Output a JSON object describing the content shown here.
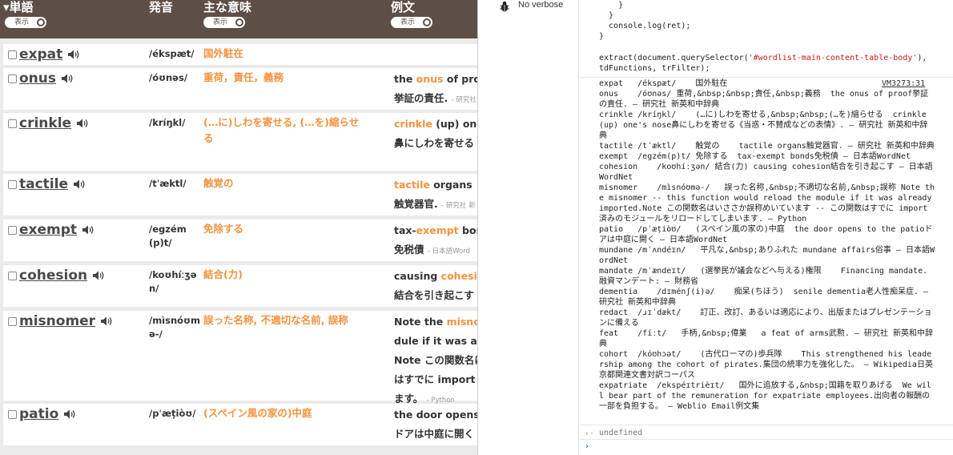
{
  "header": {
    "col_word": "▾単語",
    "col_pron": "発音",
    "col_meaning": "主な意味",
    "col_example": "例文",
    "toggle_label": "表示"
  },
  "rows": [
    {
      "word": "expat",
      "pron": "/ékspæt/",
      "meaning": "国外駐在",
      "example": []
    },
    {
      "word": "onus",
      "pron": "/óʊnəs/",
      "meaning": "重荷，責任，義務",
      "example": [
        [
          "the ",
          "onus",
          " of proof"
        ],
        [
          "挙証の責任.",
          "",
          ""
        ]
      ],
      "source": "- 研究社"
    },
    {
      "word": "crinkle",
      "pron": "/kríŋkl/",
      "meaning": "(…に)しわを寄せる, (…を)縮らせる",
      "example": [
        [
          "",
          "crinkle",
          " (up) one's"
        ],
        [
          "鼻にしわを寄せる",
          "",
          ""
        ]
      ],
      "source": "和中辞典"
    },
    {
      "word": "tactile",
      "pron": "/tˈæktl/",
      "meaning": "触覚の",
      "example": [
        [
          "",
          "tactile",
          " organs"
        ],
        [
          "触覚器官.",
          "",
          ""
        ]
      ],
      "source": "- 研究社 新"
    },
    {
      "word": "exempt",
      "pron": "/egzém(p)t/",
      "meaning": "免除する",
      "example": [
        [
          "tax-",
          "exempt",
          " bonds"
        ],
        [
          "免税債",
          "",
          ""
        ]
      ],
      "source": "- 日本語Word"
    },
    {
      "word": "cohesion",
      "pron": "/koʊhíːʒən/",
      "meaning": "結合(力)",
      "example": [
        [
          "causing ",
          "cohesion",
          ""
        ],
        [
          "結合を引き起こす",
          "",
          ""
        ]
      ]
    },
    {
      "word": "misnomer",
      "pron": "/mìsnóʊmə-/",
      "meaning": "誤った名称, 不適切な名前, 誤称",
      "example": [
        [
          "Note the ",
          "misnomer",
          ""
        ],
        [
          "dule if it was already",
          "",
          ""
        ],
        [
          "Note この関数名は",
          "",
          ""
        ],
        [
          "はすでに import 済",
          "",
          ""
        ],
        [
          "ます。",
          "",
          ""
        ]
      ],
      "source": "- Python"
    },
    {
      "word": "patio",
      "pron": "/pˈæṭiòʊ/",
      "meaning": "(スペイン風の家の)中庭",
      "example": [
        [
          "the door opens to",
          "",
          ""
        ],
        [
          "ドアは中庭に開く",
          "",
          ""
        ]
      ]
    }
  ],
  "console": {
    "verbose_label": "No verbose",
    "code_lines": [
      "    }",
      "  }",
      "  console.log(ret);",
      "}"
    ],
    "command_prefix": "extract(document.querySelector(",
    "command_string": "'#wordlist-main-content-table-body'",
    "command_suffix": "), tdFunctions, trFilter);",
    "vm_link": "VM3273:31",
    "output": "expat   /ékspæt/    国外駐在\nonus    /óʊnəs/ 重荷,&nbsp;&nbsp;責任,&nbsp;義務  the onus of proof挙証の責任. – 研究社 新英和中辞典\ncrinkle /kríŋkl/    (…に)しわを寄せる,&nbsp;&nbsp;(…を)縮らせる  crinkle (up) one's nose鼻にしわを寄せる《当惑・不賛成などの表情》. – 研究社 新英和中辞典\ntactile /tˈæktl/    触覚の    tactile organs触覚器官. – 研究社 新英和中辞典\nexempt  /egzém(p)t/ 免除する  tax-exempt bonds免税債 – 日本語WordNet\ncohesion    /koʊhíːʒən/ 結合(力) causing cohesion結合を引き起こす – 日本語WordNet\nmisnomer    /mìsnóʊmə-/   誤った名称,&nbsp;不適切な名前,&nbsp;誤称 Note the misnomer -- this function would reload the module if it was already imported.Note この関数名はいささか誤称めいています -- この関数はすでに import 済みのモジュールをリロードしてしまいます. – Python\npatio   /pˈæṭiòʊ/   (スペイン風の家の)中庭  the door opens to the patioドアは中庭に開く – 日本語WordNet\nmundane /mˈʌndéɪn/   平凡な,&nbsp;ありふれた mundane affairs俗事 – 日本語WordNet\nmandate /mˈændeɪt/   (選挙民が議会などへ与える)権限    Financing mandate.融資マンデート: – 財務省\ndementia    /dɪménʃ(i)ə/    痴呆(ちほう)  senile dementia老人性痴呆症. – 研究社 新英和中辞典\nredact  /ɹɪˈdækt/    訂正、改訂、あるいは適応により、出版またはプレゼンテーションに備える\nfeat    /fíːt/   手柄,&nbsp;偉業   a feat of arms武勲. – 研究社 新英和中辞典\ncohort  /kóʊhɔət/    (古代ローマの)歩兵隊    This strengthened his leadership among the cohort of pirates.集団の統率力を強化した。 – Wikipedia日英京都関連文書対訳コーパス\nexpatriate  /ekspéɪtrièɪt/   国外に追放する,&nbsp;国籍を取りあげる  We will bear part of the remuneration for expatriate employees.出向者の報酬の一部を負担する。 – Weblio Email例文集",
    "result_arrow": "‹·",
    "result": "undefined",
    "prompt": "›"
  }
}
